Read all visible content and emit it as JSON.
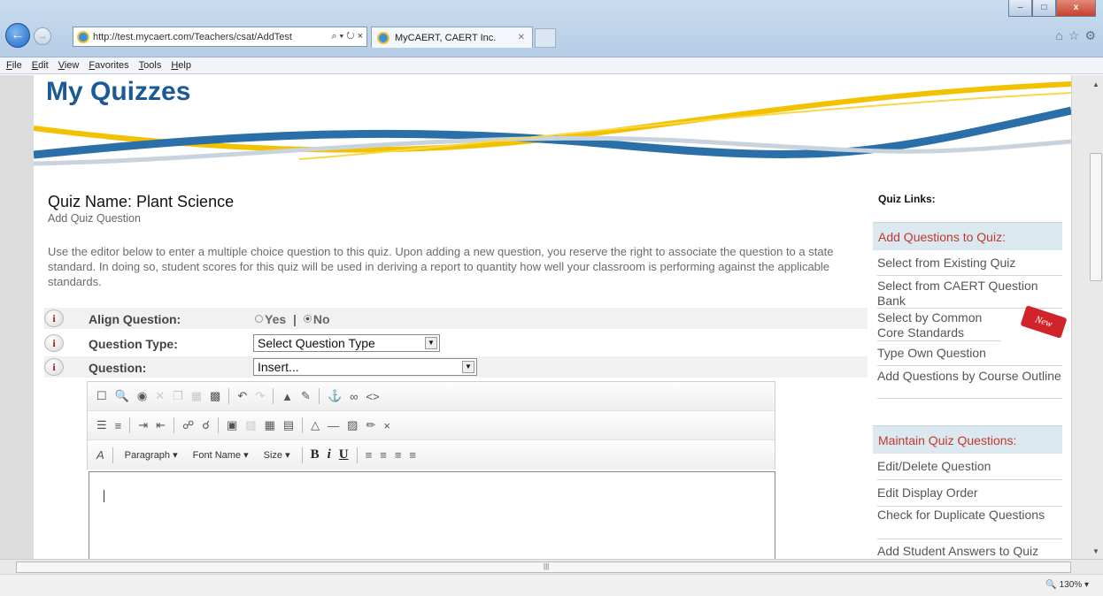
{
  "browser": {
    "url": "http://test.mycaert.com/Teachers/csat/AddTest",
    "addr_controls": "⌕ ▾ ↻ ×",
    "tab_title": "MyCAERT, CAERT Inc.",
    "zoom": "130%",
    "menu": [
      "File",
      "Edit",
      "View",
      "Favorites",
      "Tools",
      "Help"
    ],
    "win_buttons": {
      "min": "–",
      "max": "□",
      "close": "x"
    },
    "toolbar_icons": [
      "home-icon",
      "star-icon",
      "gear-icon"
    ]
  },
  "banner": {
    "title": "My Quizzes"
  },
  "quiz": {
    "name": "Quiz Name: Plant Science",
    "subtitle": "Add Quiz Question",
    "intro": "Use the editor below to enter a multiple choice question to this quiz.  Upon adding a new question, you reserve the right to associate the question to a state standard.  In doing so, student scores for this quiz will be used in deriving a report to quantity how well your classroom is performing against the applicable standards."
  },
  "form": {
    "align_label": "Align Question:",
    "align_yes": "Yes",
    "align_sep": "|",
    "align_no": "No",
    "align_selected": "No",
    "type_label": "Question Type:",
    "type_value": "Select Question Type",
    "question_label": "Question:",
    "insert_value": "Insert...",
    "info_glyph": "i"
  },
  "editor": {
    "paragraph": "Paragraph",
    "font_name": "Font Name",
    "size": "Size",
    "bold": "B",
    "italic": "i",
    "underline": "U"
  },
  "sidebar": {
    "title": "Quiz Links:",
    "add_header": "Add Questions to Quiz:",
    "add_links": [
      "Select from Existing Quiz",
      "Select from CAERT Question Bank",
      "Select by Common Core Standards",
      "Type Own Question",
      "Add Questions by Course Outline"
    ],
    "new_badge": "New",
    "maintain_header": "Maintain Quiz Questions:",
    "maintain_links": [
      "Edit/Delete Question",
      "Edit Display Order",
      "Check for Duplicate Questions",
      "Add Student Answers to Quiz"
    ]
  },
  "colors": {
    "brand_blue": "#1a5a96",
    "accent_red": "#c0392b",
    "swoosh_gold": "#f2c200"
  }
}
